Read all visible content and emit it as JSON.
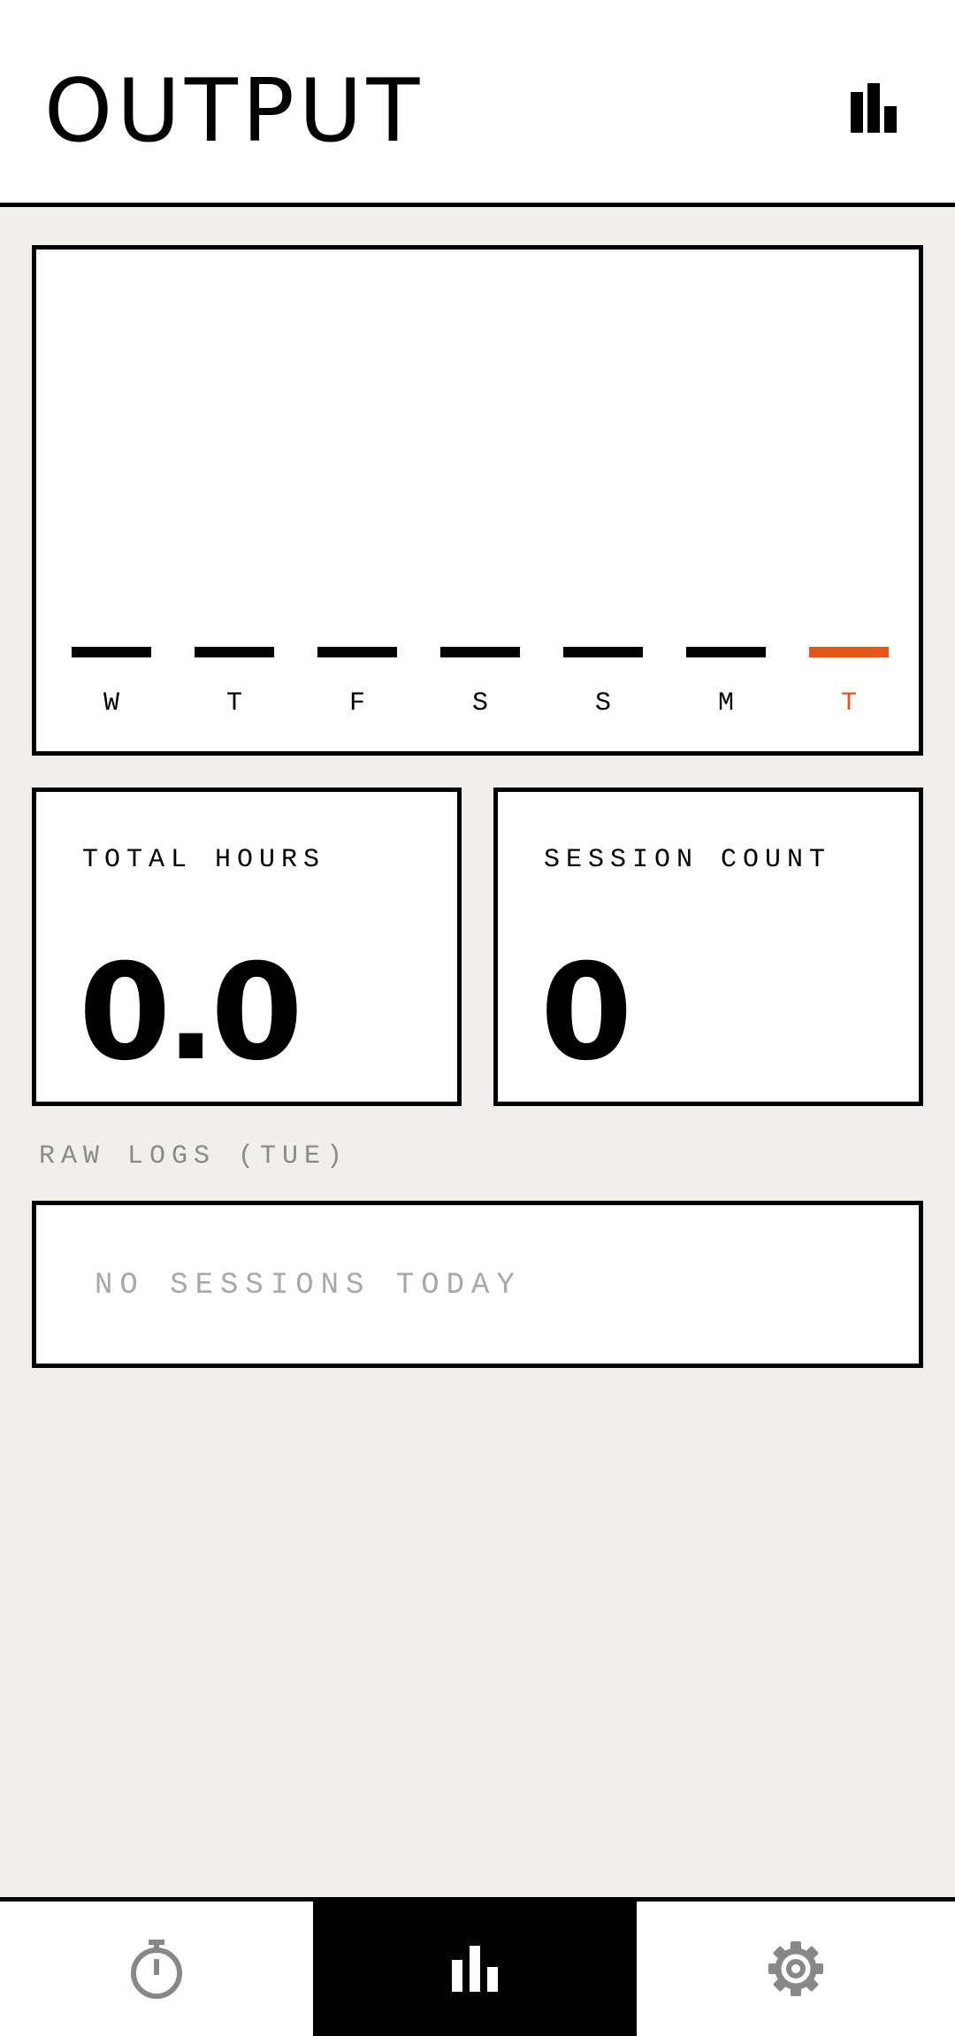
{
  "header": {
    "title": "OUTPUT",
    "icon": "bar-chart-icon"
  },
  "chart_data": {
    "type": "bar",
    "categories": [
      "W",
      "T",
      "F",
      "S",
      "S",
      "M",
      "T"
    ],
    "values": [
      0,
      0,
      0,
      0,
      0,
      0,
      0
    ],
    "highlight_index": 6,
    "bar_color": "#000000",
    "highlight_color": "#e8541a",
    "title": "",
    "xlabel": "",
    "ylabel": ""
  },
  "stats": {
    "total_hours": {
      "label": "TOTAL HOURS",
      "value": "0.0"
    },
    "session_count": {
      "label": "SESSION COUNT",
      "value": "0"
    }
  },
  "logs": {
    "section_label": "RAW LOGS (TUE)",
    "empty_text": "NO SESSIONS TODAY"
  },
  "bottom_nav": {
    "items": [
      {
        "icon": "timer-icon",
        "active": false
      },
      {
        "icon": "bar-chart-icon",
        "active": true
      },
      {
        "icon": "gear-icon",
        "active": false
      }
    ],
    "active_color": "#000000",
    "inactive_icon_color": "#888888"
  }
}
